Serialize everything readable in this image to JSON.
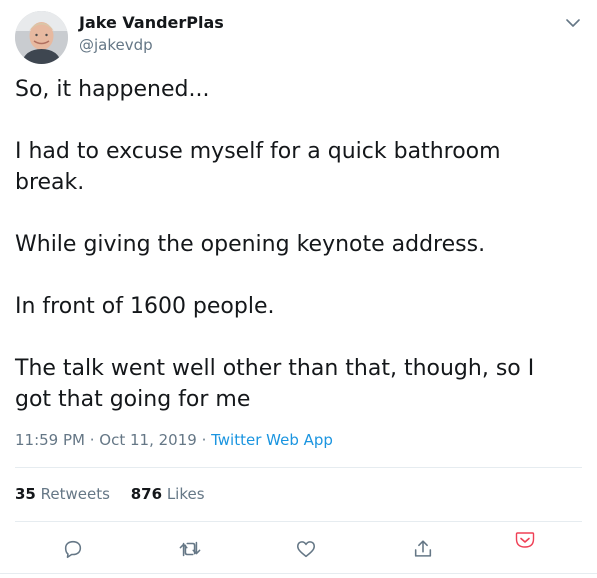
{
  "author": {
    "display_name": "Jake VanderPlas",
    "handle": "@jakevdp",
    "avatar_icon": "profile-photo"
  },
  "tweet": {
    "paragraphs": [
      "So, it happened...",
      "I had to excuse myself for a quick bathroom break.",
      "While giving the opening keynote address.",
      "In front of 1600 people.",
      "The talk went well other than that, though, so I got that going for me"
    ]
  },
  "meta": {
    "time": "11:59 PM",
    "separator": " · ",
    "date": "Oct 11, 2019",
    "source": "Twitter Web App"
  },
  "stats": {
    "retweets_count": "35",
    "retweets_label": "Retweets",
    "likes_count": "876",
    "likes_label": "Likes"
  },
  "actions": {
    "icons": [
      "reply-icon",
      "retweet-icon",
      "like-icon",
      "share-icon",
      "save-pocket-icon"
    ]
  },
  "colors": {
    "text": "#14171a",
    "secondary": "#657786",
    "link": "#1b95e0",
    "divider": "#e6ecf0",
    "pocket": "#ef4056"
  }
}
